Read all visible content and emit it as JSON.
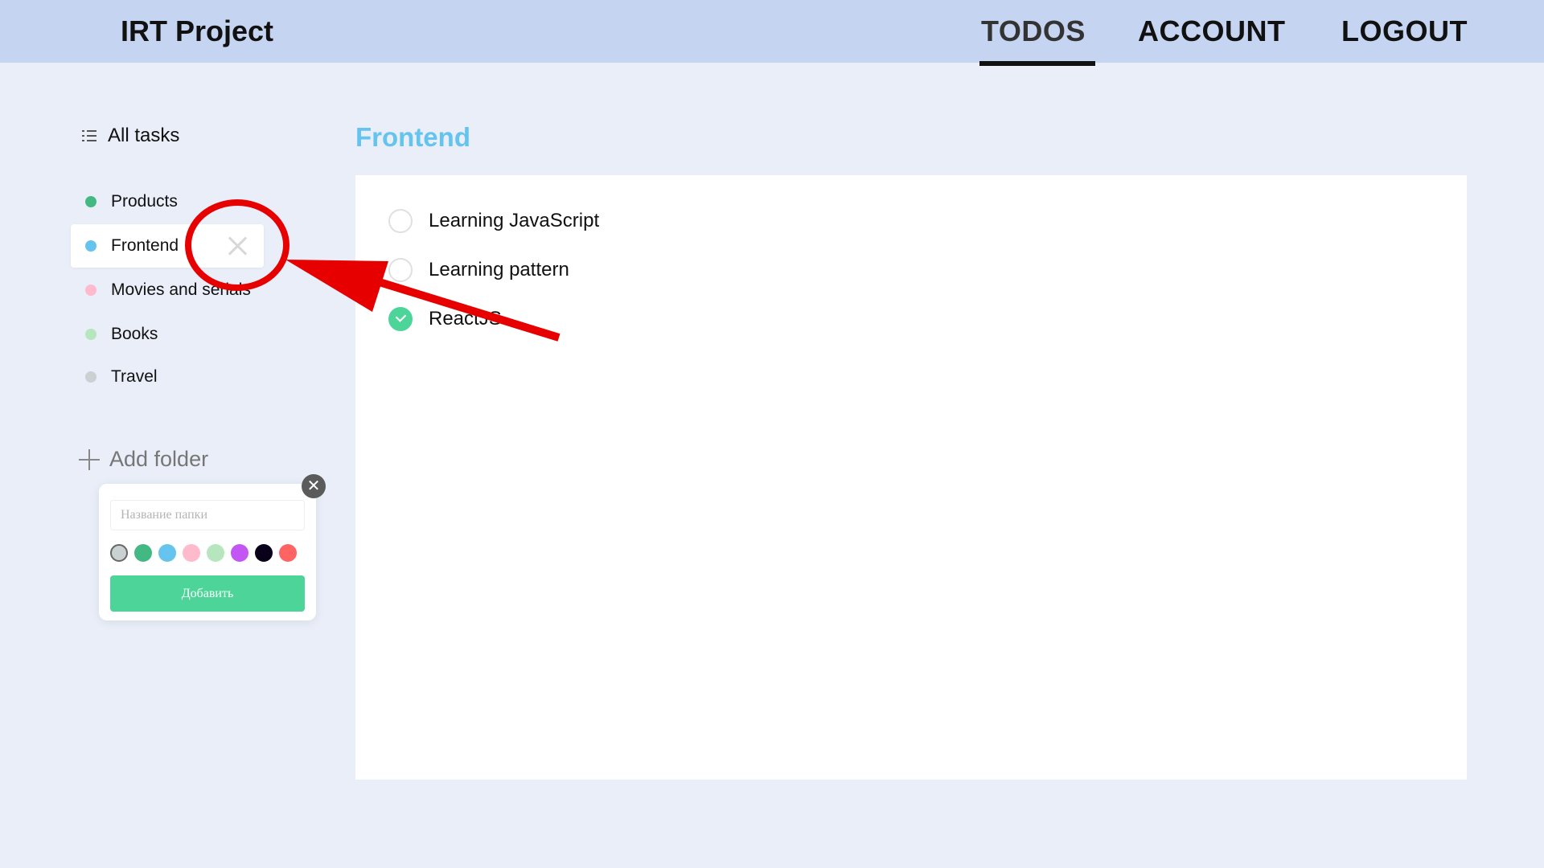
{
  "header": {
    "brand": "IRT Project",
    "nav": [
      {
        "label": "TODOS",
        "active": true
      },
      {
        "label": "ACCOUNT",
        "active": false
      },
      {
        "label": "LOGOUT",
        "active": false
      }
    ]
  },
  "sidebar": {
    "all_tasks_label": "All tasks",
    "folders": [
      {
        "label": "Products",
        "color": "#42b883"
      },
      {
        "label": "Frontend",
        "color": "#64c4ed",
        "active": true
      },
      {
        "label": "Movies and serials",
        "color": "#ffbbcc"
      },
      {
        "label": "Books",
        "color": "#b6e6bd"
      },
      {
        "label": "Travel",
        "color": "#c9d1d3"
      }
    ],
    "add_folder_label": "Add folder"
  },
  "add_folder_popup": {
    "input_placeholder": "Название папки",
    "input_value": "",
    "swatches": [
      "#c9d1d3",
      "#42b883",
      "#64c4ed",
      "#ffbbcc",
      "#b6e6bd",
      "#c355f5",
      "#09011a",
      "#ff6464"
    ],
    "selected_swatch": 0,
    "submit_label": "Добавить",
    "close_label": "✕"
  },
  "main": {
    "title": "Frontend",
    "title_color": "#64c4ed",
    "tasks": [
      {
        "text": "Learning JavaScript",
        "completed": false
      },
      {
        "text": "Learning pattern",
        "completed": false
      },
      {
        "text": "ReactJS",
        "completed": true
      }
    ]
  },
  "annotation": {
    "color": "#e60000"
  }
}
